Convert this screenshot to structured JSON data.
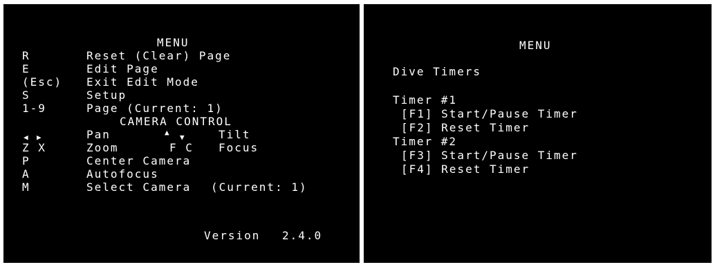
{
  "left": {
    "title": "MENU",
    "items": [
      {
        "key": "R",
        "label": "Reset (Clear) Page"
      },
      {
        "key": "E",
        "label": "Edit Page"
      },
      {
        "key": "(Esc)",
        "label": "Exit Edit Mode"
      },
      {
        "key": "S",
        "label": "Setup"
      },
      {
        "key": "1-9",
        "label": "Page (Current: 1)"
      }
    ],
    "camera_heading": "CAMERA CONTROL",
    "camera": {
      "pan_label": "Pan",
      "tilt_label": "Tilt",
      "zoom_keys": "Z X",
      "zoom_label": "Zoom",
      "focus_keys": "F C",
      "focus_label": "Focus",
      "center_key": "P",
      "center_label": "Center Camera",
      "autofocus_key": "A",
      "autofocus_label": "Autofocus",
      "select_key": "M",
      "select_label": "Select Camera",
      "select_current": "(Current: 1)"
    },
    "version_label": "Version",
    "version_value": "2.4.0"
  },
  "right": {
    "title": "MENU",
    "section": "Dive Timers",
    "timers": [
      {
        "name": "Timer #1",
        "actions": [
          "[F1] Start/Pause Timer",
          "[F2] Reset Timer"
        ]
      },
      {
        "name": "Timer #2",
        "actions": [
          "[F3] Start/Pause Timer",
          "[F4] Reset Timer"
        ]
      }
    ]
  },
  "icons": {
    "left": "left-arrow-icon",
    "right": "right-arrow-icon",
    "up": "up-arrow-icon",
    "down": "down-arrow-icon"
  },
  "colors": {
    "screen_bg": "#000000",
    "text": "#ffffff",
    "frame": "#ffffff"
  }
}
